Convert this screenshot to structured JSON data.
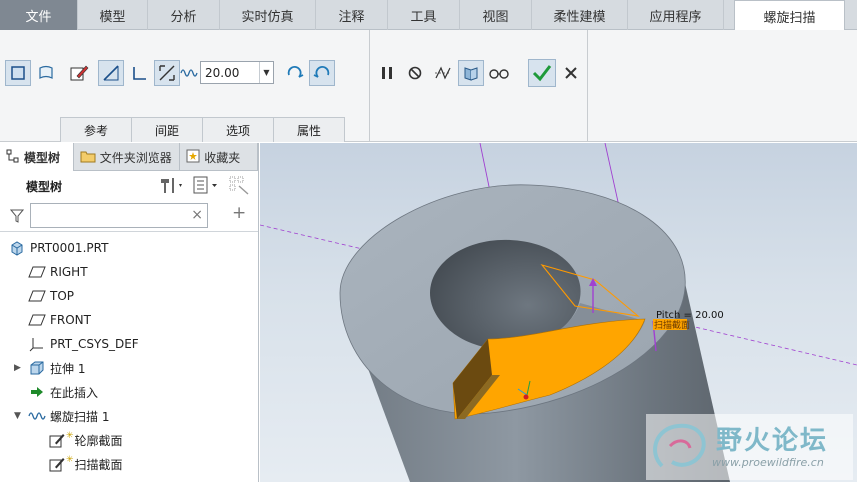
{
  "tabs": [
    {
      "label": "文件",
      "w": 78
    },
    {
      "label": "模型",
      "w": 70
    },
    {
      "label": "分析",
      "w": 72
    },
    {
      "label": "实时仿真",
      "w": 96
    },
    {
      "label": "注释",
      "w": 72
    },
    {
      "label": "工具",
      "w": 72
    },
    {
      "label": "视图",
      "w": 72
    },
    {
      "label": "柔性建模",
      "w": 96
    },
    {
      "label": "应用程序",
      "w": 96
    },
    {
      "label": "螺旋扫描",
      "w": 111
    }
  ],
  "ribbon": {
    "pitch_value": "20.00",
    "subtabs": [
      "参考",
      "间距",
      "选项",
      "属性"
    ]
  },
  "panel": {
    "tabs": [
      "模型树",
      "文件夹浏览器",
      "收藏夹"
    ],
    "tree_title": "模型树",
    "filter_placeholder": "",
    "items": [
      {
        "label": "PRT0001.PRT",
        "icon": "part-icon",
        "indent": 0,
        "expand": ""
      },
      {
        "label": "RIGHT",
        "icon": "datum-plane-icon",
        "indent": 1,
        "expand": ""
      },
      {
        "label": "TOP",
        "icon": "datum-plane-icon",
        "indent": 1,
        "expand": ""
      },
      {
        "label": "FRONT",
        "icon": "datum-plane-icon",
        "indent": 1,
        "expand": ""
      },
      {
        "label": "PRT_CSYS_DEF",
        "icon": "csys-icon",
        "indent": 1,
        "expand": ""
      },
      {
        "label": "拉伸 1",
        "icon": "extrude-icon",
        "indent": 1,
        "expand": "▶"
      },
      {
        "label": "在此插入",
        "icon": "insert-here-icon",
        "indent": 1,
        "expand": ""
      },
      {
        "label": "螺旋扫描 1",
        "icon": "helical-sweep-icon",
        "indent": 1,
        "expand": "▼"
      },
      {
        "label": "轮廓截面",
        "icon": "sketch-icon",
        "indent": 2,
        "expand": ""
      },
      {
        "label": "扫描截面",
        "icon": "sketch-icon",
        "indent": 2,
        "expand": ""
      }
    ]
  },
  "viewport": {
    "pitch_label": "Pitch = 20.00",
    "section_label": "扫描截面"
  },
  "watermark": {
    "title": "野火论坛",
    "url": "www.proewildfire.cn"
  },
  "colors": {
    "accent_orange": "#ffa500",
    "datum_purple": "#a040d0",
    "part_gray": "#9aa4ae"
  }
}
